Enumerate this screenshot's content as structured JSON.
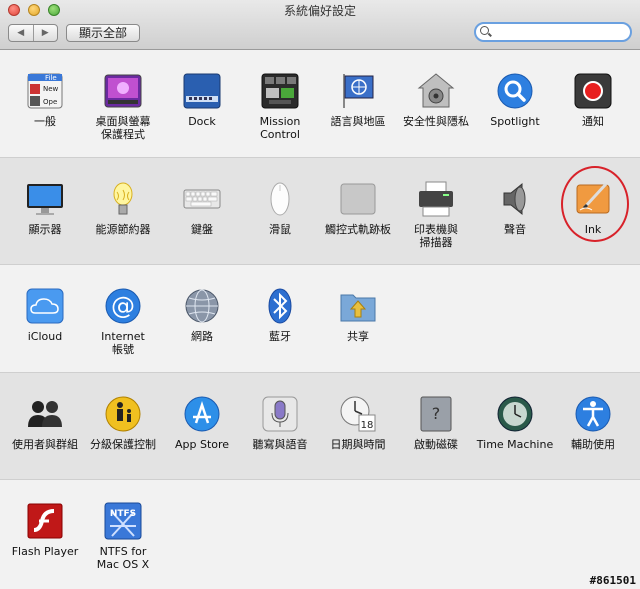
{
  "window": {
    "title": "系統偏好設定",
    "show_all_label": "顯示全部",
    "nav_back": "◀",
    "nav_forward": "▶",
    "search_value": ""
  },
  "rows": [
    {
      "items": [
        {
          "label": "一般",
          "icon": "general-icon"
        },
        {
          "label": "桌面與螢幕\n保護程式",
          "icon": "desktop-screensaver-icon"
        },
        {
          "label": "Dock",
          "icon": "dock-icon"
        },
        {
          "label": "Mission\nControl",
          "icon": "mission-control-icon"
        },
        {
          "label": "語言與地區",
          "icon": "language-region-icon"
        },
        {
          "label": "安全性與隱私",
          "icon": "security-icon"
        },
        {
          "label": "Spotlight",
          "icon": "spotlight-icon"
        },
        {
          "label": "通知",
          "icon": "notifications-icon"
        }
      ]
    },
    {
      "items": [
        {
          "label": "顯示器",
          "icon": "display-icon"
        },
        {
          "label": "能源節約器",
          "icon": "energy-saver-icon"
        },
        {
          "label": "鍵盤",
          "icon": "keyboard-icon"
        },
        {
          "label": "滑鼠",
          "icon": "mouse-icon"
        },
        {
          "label": "觸控式軌跡板",
          "icon": "trackpad-icon"
        },
        {
          "label": "印表機與\n掃描器",
          "icon": "printer-icon"
        },
        {
          "label": "聲音",
          "icon": "sound-icon"
        },
        {
          "label": "Ink",
          "icon": "ink-icon"
        }
      ]
    },
    {
      "items": [
        {
          "label": "iCloud",
          "icon": "icloud-icon"
        },
        {
          "label": "Internet\n帳號",
          "icon": "internet-accounts-icon"
        },
        {
          "label": "網路",
          "icon": "network-icon"
        },
        {
          "label": "藍牙",
          "icon": "bluetooth-icon"
        },
        {
          "label": "共享",
          "icon": "sharing-icon"
        }
      ]
    },
    {
      "items": [
        {
          "label": "使用者與群組",
          "icon": "users-groups-icon"
        },
        {
          "label": "分級保護控制",
          "icon": "parental-controls-icon"
        },
        {
          "label": "App Store",
          "icon": "app-store-icon"
        },
        {
          "label": "聽寫與語音",
          "icon": "dictation-speech-icon"
        },
        {
          "label": "日期與時間",
          "icon": "date-time-icon"
        },
        {
          "label": "啟動磁碟",
          "icon": "startup-disk-icon"
        },
        {
          "label": "Time Machine",
          "icon": "time-machine-icon"
        },
        {
          "label": "輔助使用",
          "icon": "accessibility-icon"
        }
      ]
    },
    {
      "items": [
        {
          "label": "Flash Player",
          "icon": "flash-player-icon"
        },
        {
          "label": "NTFS for\nMac OS X",
          "icon": "ntfs-icon"
        }
      ]
    }
  ],
  "watermark": "#861501",
  "icon_text": {
    "general_file": "File",
    "general_new": "New",
    "general_open": "Ope",
    "date_day": "18",
    "ntfs": "NTFS"
  }
}
